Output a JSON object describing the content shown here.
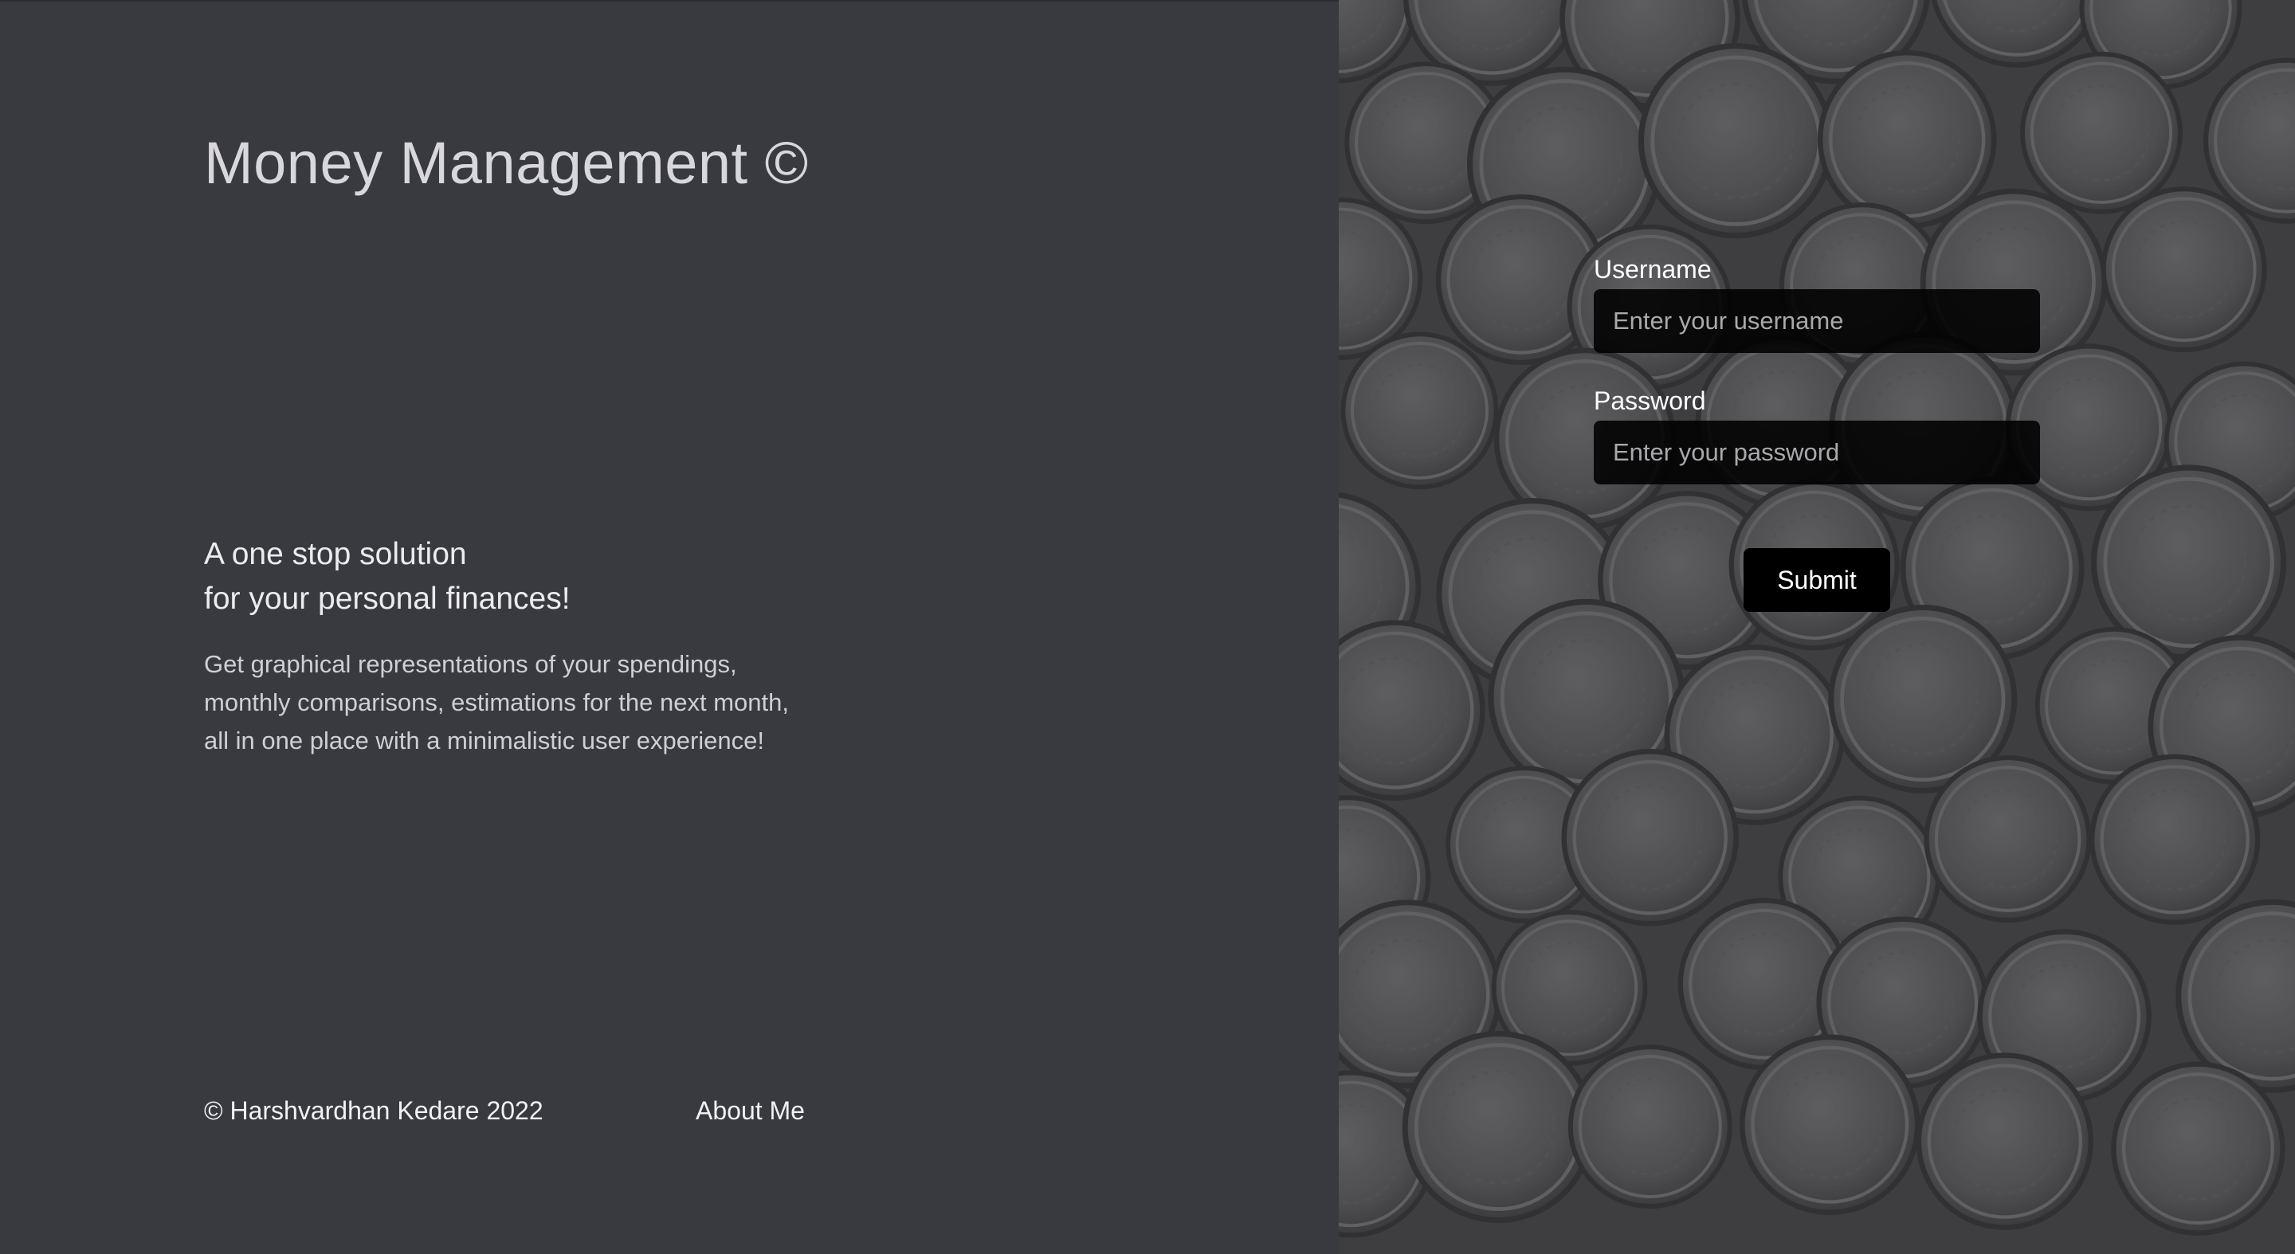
{
  "brand": {
    "title": "Money Management ©"
  },
  "hero": {
    "tagline_line1": "A one stop solution",
    "tagline_line2": "for your personal finances!",
    "description_line1": "Get graphical representations of your spendings,",
    "description_line2": "monthly comparisons, estimations for the next month,",
    "description_line3": "all in one place with a minimalistic user experience!"
  },
  "footer": {
    "copyright": "© Harshvardhan Kedare 2022",
    "about_link": "About Me"
  },
  "login": {
    "username_label": "Username",
    "username_placeholder": "Enter your username",
    "username_value": "",
    "password_label": "Password",
    "password_placeholder": "Enter your password",
    "password_value": "",
    "submit_label": "Submit"
  },
  "theme": {
    "left_panel_bg": "#393a40",
    "input_bg": "#000000",
    "background_image": "coins-photo"
  }
}
